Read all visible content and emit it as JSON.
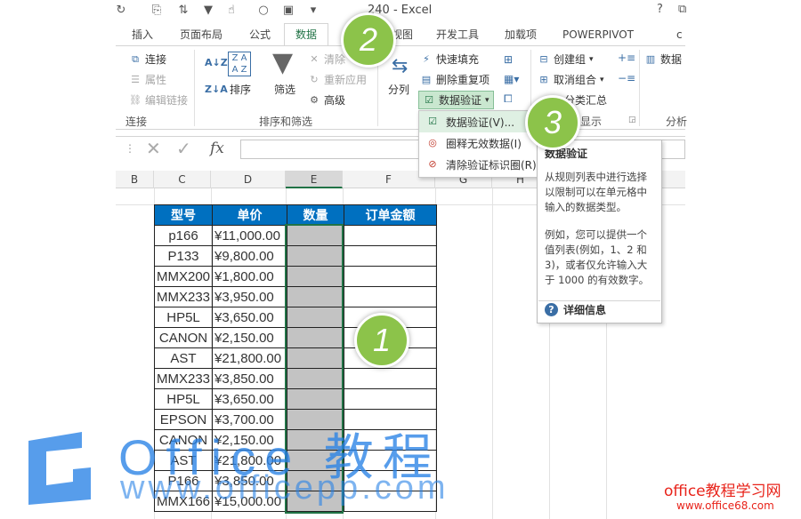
{
  "window": {
    "title": "240 - Excel",
    "help": "?",
    "restore": "⧉"
  },
  "tabs": [
    "插入",
    "页面布局",
    "公式",
    "数据",
    "视图",
    "开发工具",
    "加载项",
    "POWERPIVOT",
    "c"
  ],
  "ribbon": {
    "connections": {
      "connect": "连接",
      "properties": "属性",
      "edit_links": "编辑链接",
      "group": "连接"
    },
    "sort": {
      "sort": "排序",
      "filter": "筛选",
      "clear": "清除",
      "reapply": "重新应用",
      "advanced": "高级",
      "group": "排序和筛选"
    },
    "tools": {
      "split": "分列",
      "flash_fill": "快速填充",
      "remove_dup": "删除重复项",
      "data_validation": "数据验证"
    },
    "outline": {
      "group_btn": "创建组",
      "ungroup": "取消组合",
      "subtotal": "分类汇总",
      "group_label": "显示"
    },
    "analysis": {
      "data": "数据",
      "label": "分析"
    }
  },
  "formula": {
    "fx": "fx"
  },
  "columns": [
    "B",
    "C",
    "D",
    "E",
    "F",
    "G",
    "H"
  ],
  "table": {
    "headers": [
      "型号",
      "单价",
      "数量",
      "订单金额"
    ],
    "rows": [
      [
        "p166",
        "¥11,000.00"
      ],
      [
        "P133",
        "¥9,800.00"
      ],
      [
        "MMX200",
        "¥1,800.00"
      ],
      [
        "MMX233",
        "¥3,950.00"
      ],
      [
        "HP5L",
        "¥3,650.00"
      ],
      [
        "CANON",
        "¥2,150.00"
      ],
      [
        "AST",
        "¥21,800.00"
      ],
      [
        "MMX233",
        "¥3,850.00"
      ],
      [
        "HP5L",
        "¥3,650.00"
      ],
      [
        "EPSON",
        "¥3,700.00"
      ],
      [
        "CANON",
        "¥2,150.00"
      ],
      [
        "AST",
        "¥21,800.00"
      ],
      [
        "P166",
        "¥3,850.00"
      ],
      [
        "MMX166",
        "¥15,000.00"
      ]
    ]
  },
  "dropdown": {
    "items": [
      "数据验证(V)...",
      "圈释无效数据(I)",
      "清除验证标识圈(R)"
    ]
  },
  "tooltip": {
    "title": "数据验证",
    "p1": "从规则列表中进行选择以限制可以在单元格中输入的数据类型。",
    "p2": "例如，您可以提供一个值列表(例如，1、2 和 3)，或者仅允许输入大于 1000 的有效数字。",
    "link": "详细信息"
  },
  "callouts": [
    "1",
    "2",
    "3"
  ],
  "watermark": {
    "text": "Office 教程",
    "url": "www.officepp.com",
    "site2": "office教程学习网",
    "site2_url": "www.office68.com"
  }
}
